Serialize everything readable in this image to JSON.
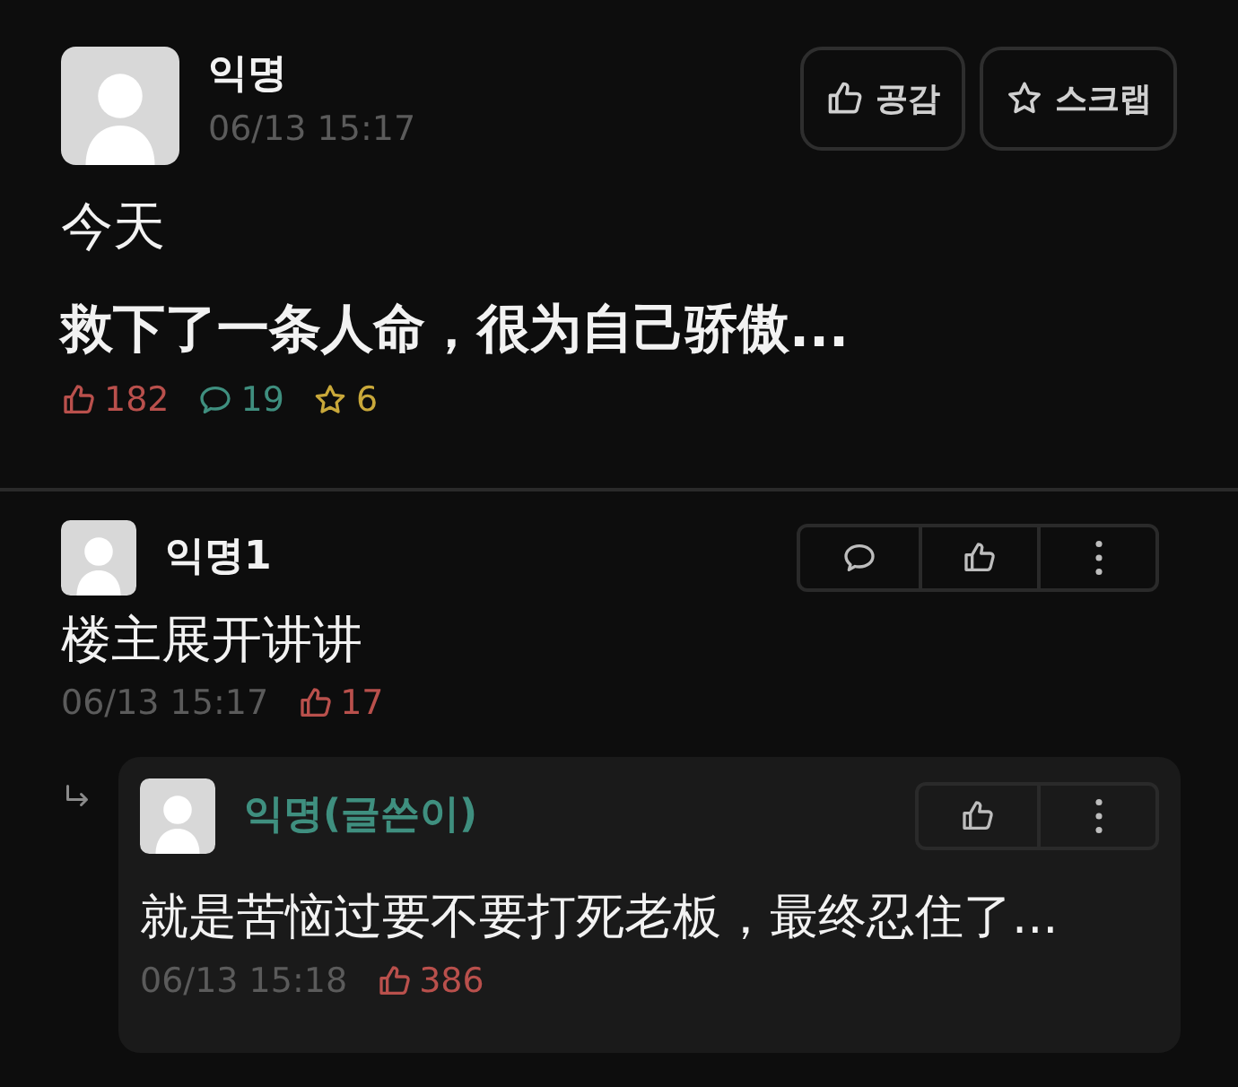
{
  "post": {
    "author": "익명",
    "time": "06/13 15:17",
    "buttons": [
      {
        "kind": "like",
        "label": "공감"
      },
      {
        "kind": "scrap",
        "label": "스크랩"
      }
    ],
    "title": "今天",
    "body": "救下了一条人命，很为自己骄傲...",
    "stats": [
      {
        "kind": "likes",
        "count": "182"
      },
      {
        "kind": "comments",
        "count": "19"
      },
      {
        "kind": "scraps",
        "count": "6"
      }
    ]
  },
  "comments": [
    {
      "author": "익명1",
      "is_author": false,
      "text": "楼主展开讲讲",
      "time": "06/13 15:17",
      "likes": "17",
      "actions": [
        {
          "kind": "comment"
        },
        {
          "kind": "like"
        },
        {
          "kind": "more"
        }
      ],
      "replies": [
        {
          "author": "익명(글쓴이)",
          "is_author": true,
          "text": "就是苦恼过要不要打死老板，最终忍住了...",
          "time": "06/13 15:18",
          "likes": "386",
          "actions": [
            {
              "kind": "like"
            },
            {
              "kind": "more"
            }
          ]
        }
      ]
    }
  ]
}
